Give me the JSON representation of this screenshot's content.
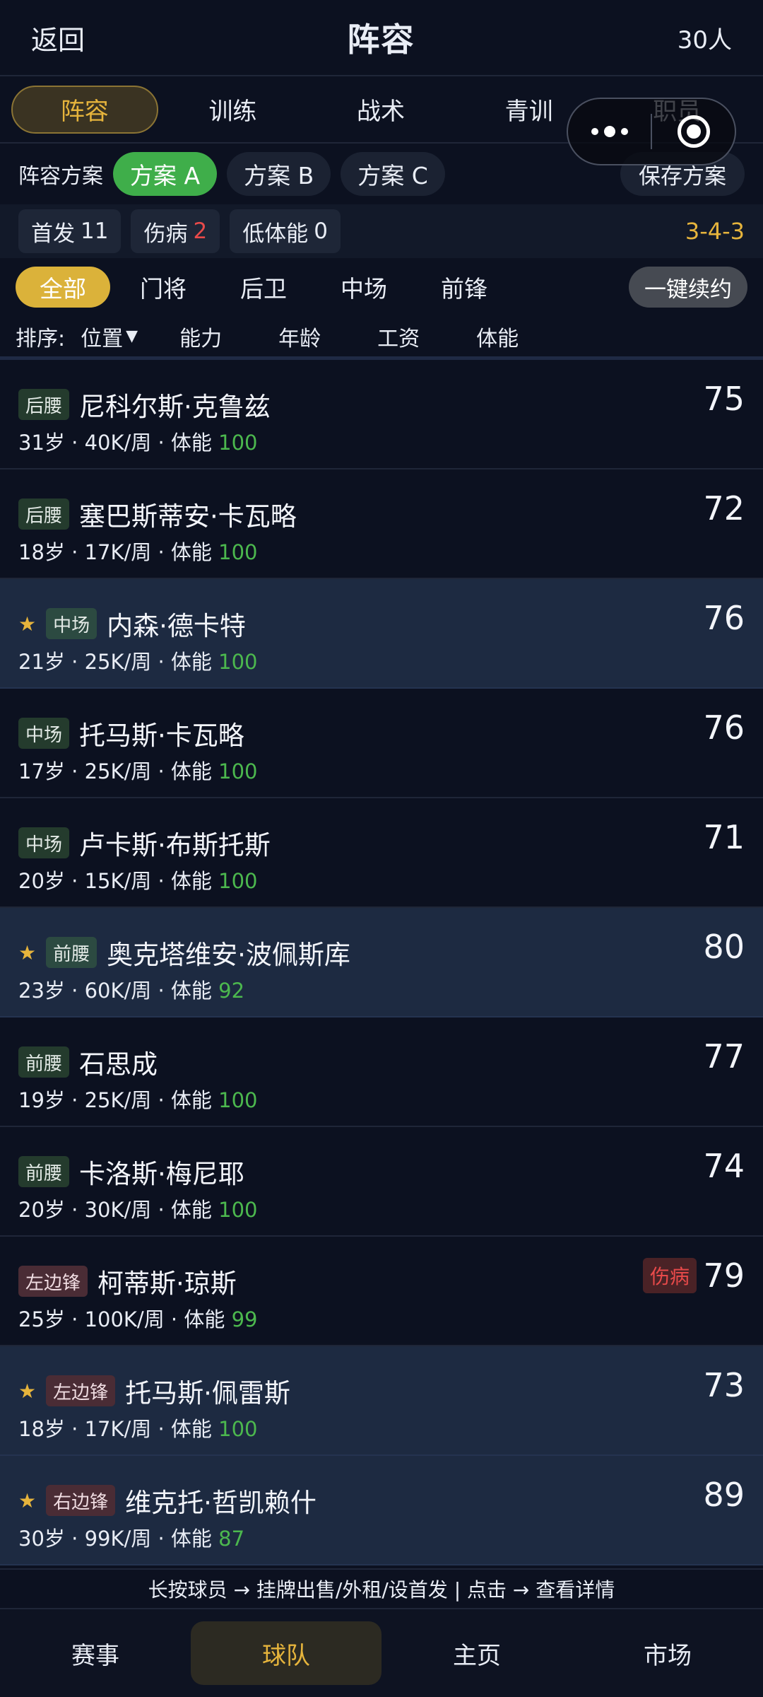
{
  "header": {
    "back": "返回",
    "title": "阵容",
    "count": "30人"
  },
  "tabs": [
    "阵容",
    "训练",
    "战术",
    "青训",
    "职员"
  ],
  "plan": {
    "label": "阵容方案",
    "options": [
      "方案 A",
      "方案 B",
      "方案 C"
    ],
    "save": "保存方案"
  },
  "stats": {
    "starters_label": "首发",
    "starters": "11",
    "injured_label": "伤病",
    "injured": "2",
    "low_label": "低体能",
    "low": "0",
    "formation": "3-4-3"
  },
  "filters": [
    "全部",
    "门将",
    "后卫",
    "中场",
    "前锋"
  ],
  "renew": "一键续约",
  "sort": {
    "label": "排序:",
    "items": [
      "位置",
      "能力",
      "年龄",
      "工资",
      "体能"
    ],
    "arrow": "▼"
  },
  "players": [
    {
      "pos": "后腰",
      "name": "尼科尔斯·克鲁兹",
      "rating": "75",
      "age": "31岁",
      "wage": "40K/周",
      "stamina_label": "体能",
      "stamina": "100"
    },
    {
      "pos": "后腰",
      "name": "塞巴斯蒂安·卡瓦略",
      "rating": "72",
      "age": "18岁",
      "wage": "17K/周",
      "stamina_label": "体能",
      "stamina": "100"
    },
    {
      "pos": "中场",
      "name": "内森·德卡特",
      "rating": "76",
      "age": "21岁",
      "wage": "25K/周",
      "stamina_label": "体能",
      "stamina": "100",
      "star": "★"
    },
    {
      "pos": "中场",
      "name": "托马斯·卡瓦略",
      "rating": "76",
      "age": "17岁",
      "wage": "25K/周",
      "stamina_label": "体能",
      "stamina": "100"
    },
    {
      "pos": "中场",
      "name": "卢卡斯·布斯托斯",
      "rating": "71",
      "age": "20岁",
      "wage": "15K/周",
      "stamina_label": "体能",
      "stamina": "100"
    },
    {
      "pos": "前腰",
      "name": "奥克塔维安·波佩斯库",
      "rating": "80",
      "age": "23岁",
      "wage": "60K/周",
      "stamina_label": "体能",
      "stamina": "92",
      "star": "★"
    },
    {
      "pos": "前腰",
      "name": "石思成",
      "rating": "77",
      "age": "19岁",
      "wage": "25K/周",
      "stamina_label": "体能",
      "stamina": "100"
    },
    {
      "pos": "前腰",
      "name": "卡洛斯·梅尼耶",
      "rating": "74",
      "age": "20岁",
      "wage": "30K/周",
      "stamina_label": "体能",
      "stamina": "100"
    },
    {
      "pos": "左边锋",
      "name": "柯蒂斯·琼斯",
      "rating": "79",
      "age": "25岁",
      "wage": "100K/周",
      "stamina_label": "体能",
      "stamina": "99",
      "injury": "伤病"
    },
    {
      "pos": "左边锋",
      "name": "托马斯·佩雷斯",
      "rating": "73",
      "age": "18岁",
      "wage": "17K/周",
      "stamina_label": "体能",
      "stamina": "100",
      "star": "★"
    },
    {
      "pos": "右边锋",
      "name": "维克托·哲凯赖什",
      "rating": "89",
      "age": "30岁",
      "wage": "99K/周",
      "stamina_label": "体能",
      "stamina": "87",
      "star": "★"
    }
  ],
  "sep": " · ",
  "hint": "长按球员 → 挂牌出售/外租/设首发 | 点击 → 查看详情",
  "nav": [
    "赛事",
    "球队",
    "主页",
    "市场"
  ],
  "colors": {
    "accent": "#e6b43c",
    "green": "#4cb84e",
    "red": "#e84a4a"
  }
}
